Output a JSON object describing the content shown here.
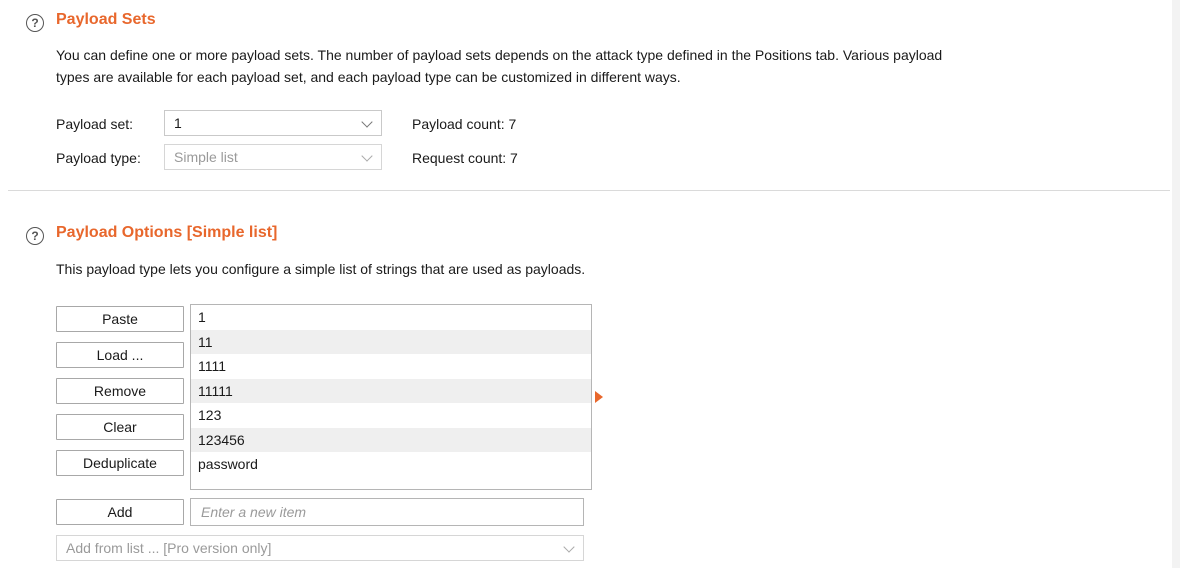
{
  "payload_sets": {
    "title": "Payload Sets",
    "description_line1": "You can define one or more payload sets. The number of payload sets depends on the attack type defined in the Positions tab. Various payload",
    "description_line2": "types are available for each payload set, and each payload type can be customized in different ways.",
    "set_label": "Payload set:",
    "set_value": "1",
    "type_label": "Payload type:",
    "type_value": "Simple list",
    "payload_count": "Payload count: 7",
    "request_count": "Request count: 7"
  },
  "payload_options": {
    "title": "Payload Options [Simple list]",
    "description": "This payload type lets you configure a simple list of strings that are used as payloads.",
    "buttons": {
      "paste": "Paste",
      "load": "Load ...",
      "remove": "Remove",
      "clear": "Clear",
      "deduplicate": "Deduplicate",
      "add": "Add"
    },
    "items": [
      "1",
      "11",
      "1111",
      "11111",
      "123",
      "123456",
      "password"
    ],
    "new_item_placeholder": "Enter a new item",
    "add_from_list": "Add from list ... [Pro version only]"
  },
  "colors": {
    "accent": "#e8672c"
  }
}
